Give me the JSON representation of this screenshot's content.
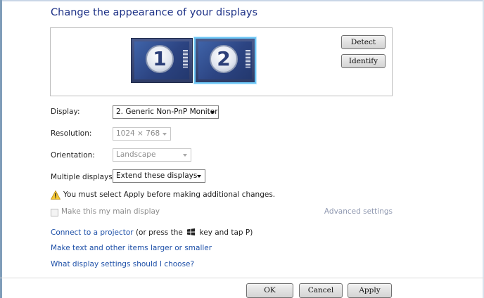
{
  "header": {
    "title": "Change the appearance of your displays"
  },
  "preview": {
    "monitors": [
      {
        "label": "1"
      },
      {
        "label": "2"
      }
    ],
    "detect_label": "Detect",
    "identify_label": "Identify"
  },
  "settings": {
    "display": {
      "label": "Display:",
      "value": "2. Generic Non-PnP Monitor"
    },
    "resolution": {
      "label": "Resolution:",
      "value": "1024 × 768"
    },
    "orientation": {
      "label": "Orientation:",
      "value": "Landscape"
    },
    "multiple": {
      "label": "Multiple displays:",
      "value": "Extend these displays"
    }
  },
  "warning": {
    "icon": "warning-icon",
    "text": "You must select Apply before making additional changes."
  },
  "main_display": {
    "label": "Make this my main display",
    "checked": false
  },
  "advanced_label": "Advanced settings",
  "links": {
    "projector": "Connect to a projector",
    "projector_suffix_a": "(or press the",
    "projector_suffix_b": "key and tap P)",
    "larger": "Make text and other items larger or smaller",
    "which": "What display settings should I choose?"
  },
  "footer": {
    "ok": "OK",
    "cancel": "Cancel",
    "apply": "Apply"
  },
  "colors": {
    "title": "#1e3287",
    "link": "#1e50a8",
    "monitor_selected": "#6cc6f5"
  }
}
